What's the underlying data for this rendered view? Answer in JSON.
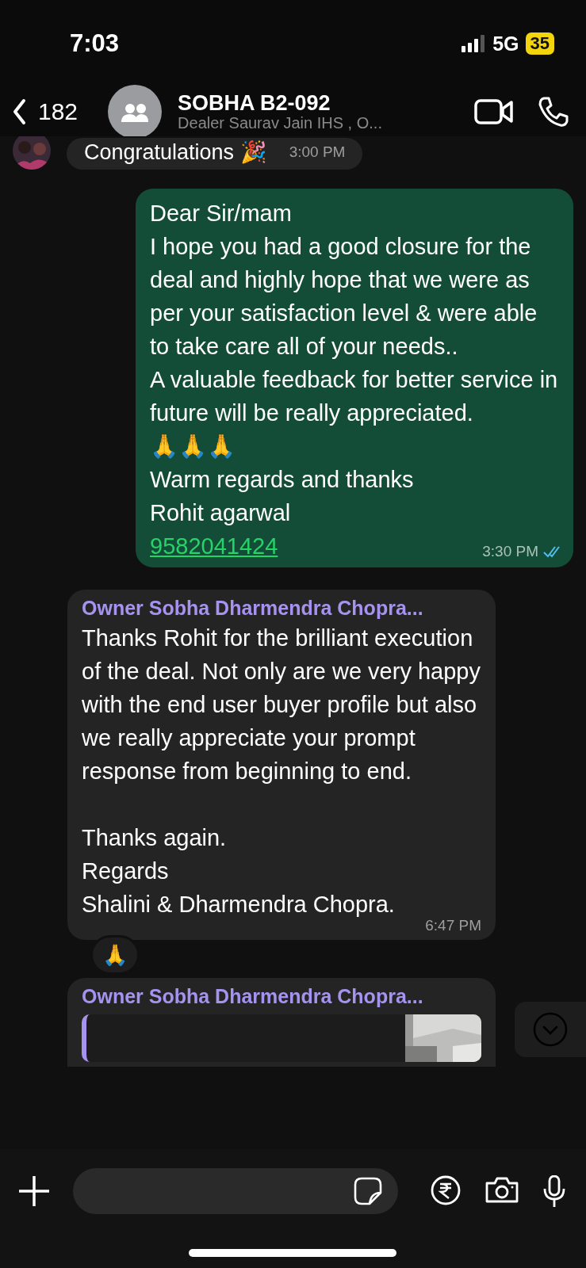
{
  "status_bar": {
    "time": "7:03",
    "network": "5G",
    "battery": "35"
  },
  "header": {
    "back_count": "182",
    "title": "SOBHA B2-092",
    "subtitle": "Dealer Saurav Jain IHS , O..."
  },
  "messages": [
    {
      "kind": "received",
      "avatar": true,
      "text": "Congratulations 🎉",
      "time": "3:00 PM"
    },
    {
      "kind": "sent",
      "text": "Dear Sir/mam\nI hope you had a good closure for the deal and highly hope that we were as per your satisfaction level & were able to take care all of your needs..\nA valuable feedback for better service in future will be really appreciated.\n🙏🙏🙏\nWarm regards and thanks\nRohit agarwal",
      "link": "9582041424",
      "time": "3:30 PM",
      "read": true
    },
    {
      "kind": "received",
      "sender": "Owner Sobha Dharmendra Chopra...",
      "text": "Thanks Rohit for the brilliant execution of the deal. Not only are we very happy with the end user buyer profile but also we really appreciate your prompt response from beginning to end.\n\nThanks again.\nRegards\nShalini & Dharmendra Chopra.",
      "time": "6:47 PM",
      "reaction": "🙏"
    },
    {
      "kind": "quote",
      "sender": "Owner Sobha Dharmendra Chopra..."
    }
  ]
}
